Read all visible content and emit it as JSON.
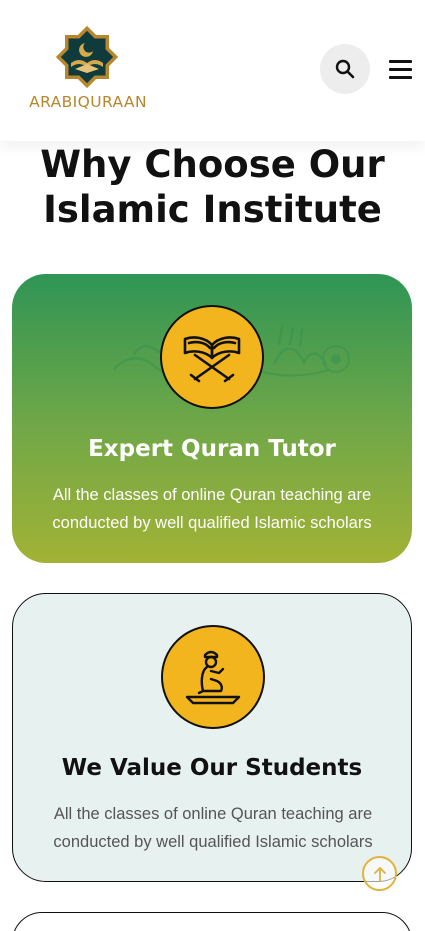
{
  "header": {
    "brand": "ARABIQURAAN",
    "logo_icon": "crescent-star-logo-icon",
    "search_icon": "search-icon",
    "menu_icon": "hamburger-menu-icon"
  },
  "section": {
    "title_line1": "Why Choose Our",
    "title_line2": "Islamic Institute"
  },
  "cards": [
    {
      "icon": "open-quran-icon",
      "title": "Expert Quran Tutor",
      "text_line1": "All the classes of online Quran teaching are",
      "text_line2": "conducted by well qualified Islamic scholars"
    },
    {
      "icon": "praying-person-icon",
      "title": "We Value Our Students",
      "text_line1": "All the classes of online Quran teaching are",
      "text_line2": "conducted by well qualified Islamic scholars"
    }
  ],
  "scroll_top": {
    "icon": "arrow-up-icon"
  },
  "colors": {
    "brand_gold": "#b8862c",
    "card_green_top": "#2f9555",
    "card_green_bottom": "#a2b235",
    "icon_yellow": "#f2b51e",
    "card_light": "#e7f1ef"
  }
}
